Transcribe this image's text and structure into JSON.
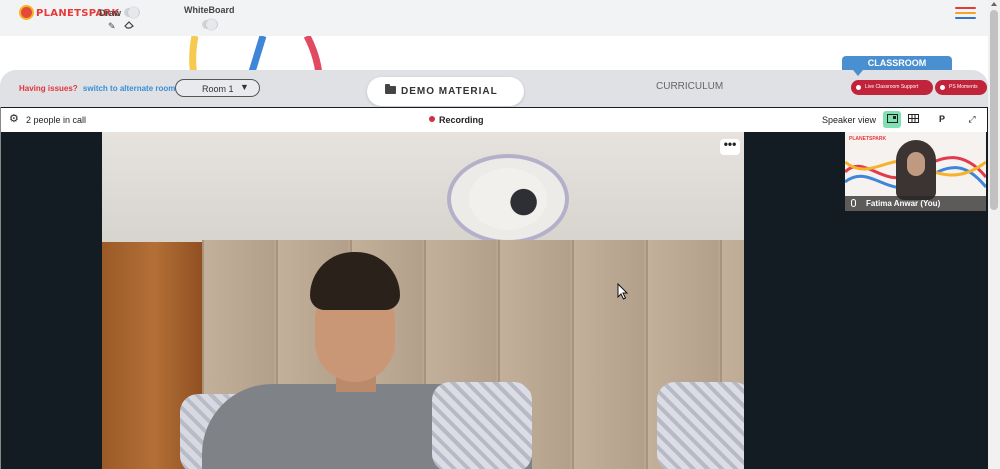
{
  "brand": {
    "name": "PLANETSPARK"
  },
  "toolbar": {
    "draw_label": "Draw",
    "whiteboard_label": "WhiteBoard",
    "draw_toggle": "off",
    "whiteboard_toggle": "off",
    "draw_tools": [
      "pencil-icon",
      "eraser-icon"
    ],
    "menu_icon": "hamburger-menu-icon",
    "menu_colors": [
      "#e33b3b",
      "#f0a62a",
      "#3a72c9"
    ]
  },
  "nav": {
    "issues_label": "Having issues?",
    "alternate_room_link": "switch to alternate room",
    "room_select": {
      "selected": "Room 1"
    },
    "demo_material_label": "DEMO MATERIAL",
    "curriculum_label": "CURRICULUM",
    "classroom_tab_label": "CLASSROOM",
    "live_support_label": "Live Classroom Support",
    "ps_moments_label": "PS Moments"
  },
  "call": {
    "people_count_label": "2 people in call",
    "recording_label": "Recording",
    "speaker_view_label": "Speaker view",
    "view_buttons": [
      "speaker-view-icon",
      "grid-view-icon",
      "P",
      "fullscreen-icon"
    ],
    "more_options_label": "•••",
    "self_view_name": "Fatima Anwar (You)",
    "self_view_brand": "PLANETSPARK"
  },
  "colors": {
    "accent_red": "#c0233a",
    "accent_blue": "#4a90d0",
    "recording_dot": "#d0313f",
    "active_view_button": "#7fe0b4"
  }
}
